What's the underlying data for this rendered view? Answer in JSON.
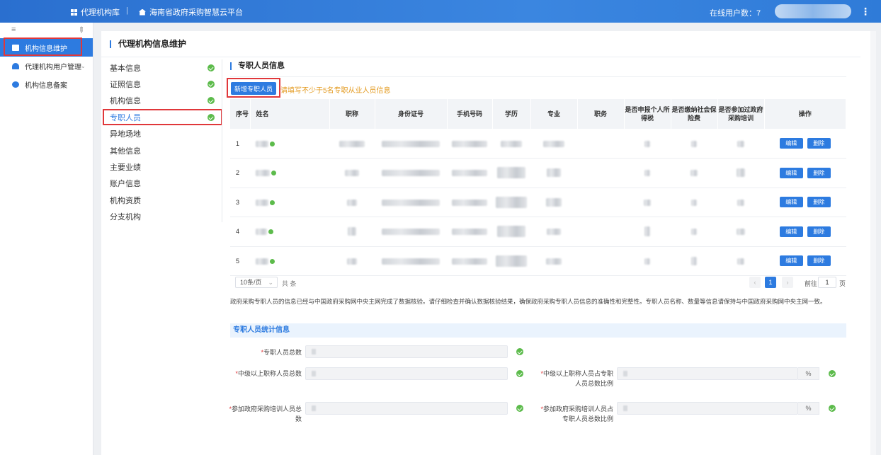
{
  "topbar": {
    "app_name": "代理机构库",
    "separator": "|",
    "platform": "海南省政府采购智慧云平台",
    "online_label": "在线用户数：7",
    "more_icon": "⋮"
  },
  "sidebar": {
    "items": [
      {
        "label": "机构信息维护",
        "icon": "building-icon"
      },
      {
        "label": "代理机构用户管理",
        "icon": "users-icon"
      },
      {
        "label": "机构信息备案",
        "icon": "gear-icon"
      }
    ]
  },
  "main": {
    "title": "代理机构信息维护",
    "nav": [
      "基本信息",
      "证照信息",
      "机构信息",
      "专职人员",
      "异地场地",
      "其他信息",
      "主要业绩",
      "账户信息",
      "机构资质",
      "分支机构"
    ],
    "section_title": "专职人员信息",
    "add_button": "新增专职人员",
    "tip": "请填写不少于5名专职从业人员信息"
  },
  "table": {
    "columns": [
      "序号",
      "姓名",
      "职称",
      "身份证号",
      "手机号码",
      "学历",
      "专业",
      "职务",
      "是否申报个人所得税",
      "是否缴纳社会保险费",
      "是否参加过政府采购培训",
      "操作"
    ],
    "rows": [
      {
        "no": "1",
        "edit": "编辑",
        "delete": "删除"
      },
      {
        "no": "2",
        "edit": "编辑",
        "delete": "删除"
      },
      {
        "no": "3",
        "edit": "编辑",
        "delete": "删除"
      },
      {
        "no": "4",
        "edit": "编辑",
        "delete": "删除"
      },
      {
        "no": "5",
        "edit": "编辑",
        "delete": "删除"
      }
    ]
  },
  "pager": {
    "page_size": "10条/页",
    "total": "共   条",
    "current_page": "1",
    "goto_label": "前往",
    "goto_value": "1",
    "goto_unit": "页"
  },
  "notice": "政府采购专职人员的信息已经与中国政府采购网中央主网完成了数据核验。请仔细检查并确认数据核验结果，确保政府采购专职人员信息的准确性和完整性。专职人员名称、数量等信息请保持与中国政府采购网中央主网一致。",
  "stats": {
    "title": "专职人员统计信息",
    "fields": [
      {
        "label": "专职人员总数",
        "required": "*"
      },
      {
        "label": "中级以上职称人员总数",
        "required": "*"
      },
      {
        "label": "中级以上职称人员占专职人员总数比例",
        "required": "*",
        "unit": "%"
      },
      {
        "label": "参加政府采购培训人员总数",
        "required": "*"
      },
      {
        "label": "参加政府采购培训人员占专职人员总数比例",
        "required": "*",
        "unit": "%"
      }
    ]
  },
  "colors": {
    "accent": "#2d7be0",
    "ok": "#5cbb4b",
    "warn": "#e39a1f",
    "highlight": "#e0373a"
  }
}
